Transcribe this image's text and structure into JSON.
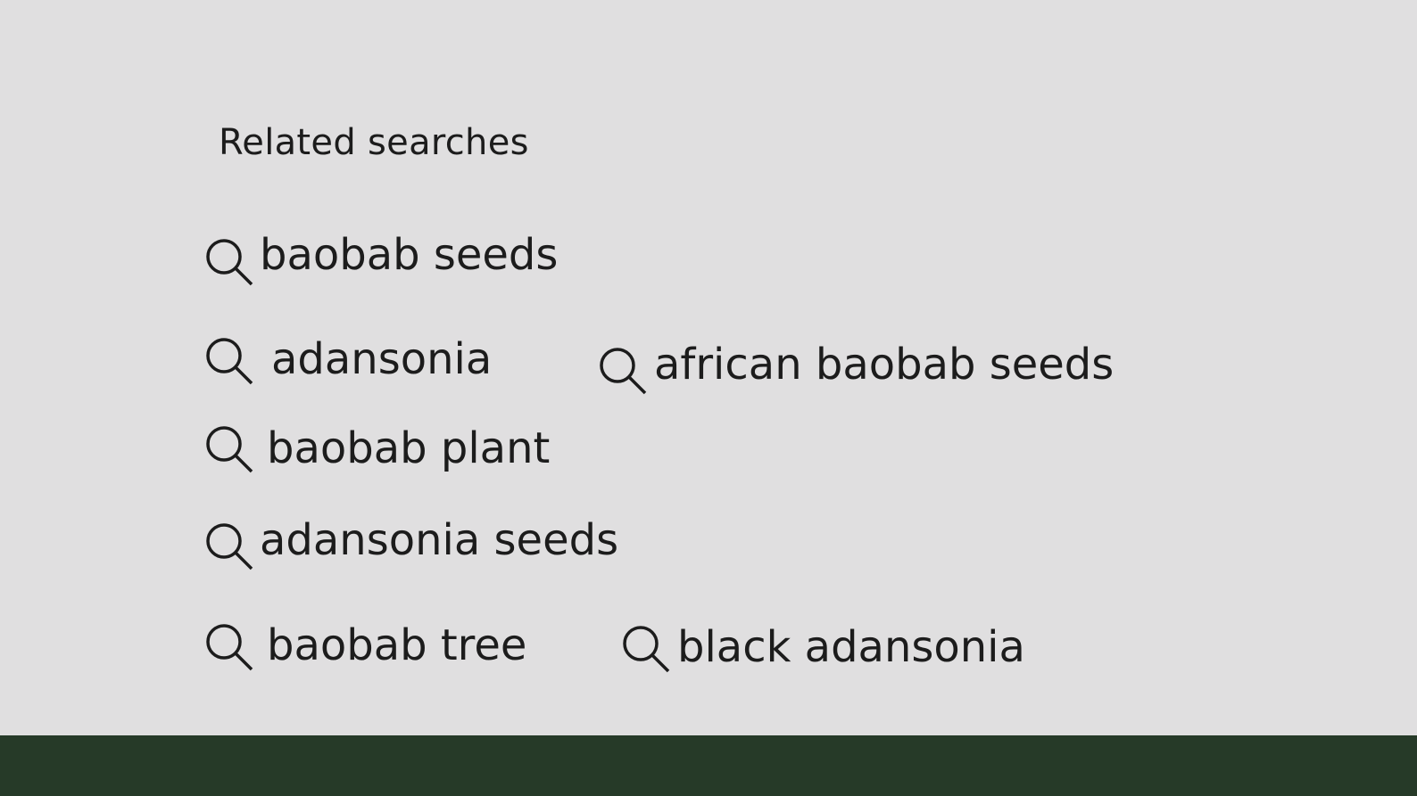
{
  "related": {
    "heading": "Related searches",
    "icon": "search-icon",
    "items": [
      {
        "label": "baobab seeds"
      },
      {
        "label": "adansonia"
      },
      {
        "label": "african baobab seeds"
      },
      {
        "label": "baobab plant"
      },
      {
        "label": "adansonia seeds"
      },
      {
        "label": "baobab tree"
      },
      {
        "label": "black adansonia"
      }
    ]
  },
  "colors": {
    "background": "#e0dfe0",
    "text": "#1c1c1c",
    "footer": "#263a28"
  }
}
